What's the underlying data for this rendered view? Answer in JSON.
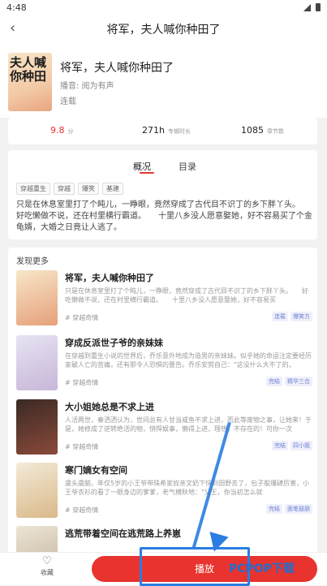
{
  "status_bar": {
    "time": "4:48"
  },
  "nav": {
    "title": "将军，夫人喊你种田了"
  },
  "book": {
    "cover_text": "夫人喊你种田",
    "title": "将军，夫人喊你种田了",
    "narrator": "播音: 阅为有声",
    "status": "连载"
  },
  "stats": [
    {
      "value": "9.8",
      "unit": "分"
    },
    {
      "value": "271h",
      "unit": "专辑时长"
    },
    {
      "value": "1085",
      "unit": "章节数"
    }
  ],
  "tabs": {
    "overview": "概况",
    "catalog": "目录"
  },
  "tags": [
    "穿越重生",
    "穿越",
    "爆笑",
    "基建"
  ],
  "synopsis": "只是在休息室里打了个盹儿，一睁眼，竟然穿成了古代目不识丁的乡下胖丫头。　　好吃懒做不说，还在村里横行霸道。　　十里八乡没人愿意娶她，好不容易买了个金龟婿，大婚之日竟让人逃了。",
  "discover": {
    "heading": "发现更多",
    "items": [
      {
        "title": "将军，夫人喊你种田了",
        "desc": "只是在休息室里打了个盹儿，一睁眼，竟然穿成了古代目不识丁的乡下胖丫头。　　好吃懒做不说，还在村里横行霸道。　　十里八乡没人愿意娶她，好不容易买",
        "genre": "# 穿越奇情",
        "tags": [
          "连载",
          "爆笑方"
        ]
      },
      {
        "title": "穿成反派世子爷的亲妹妹",
        "desc": "在穿越到重生小说的世界后，乔乐意外地成为造男的亲妹妹。似乎她的命运注定要经历家破人亡的苦痛，还有那令人恐惧的噩告。乔乐安努自己：\"这没什么大不了的，",
        "genre": "# 穿越奇情",
        "tags": [
          "完结",
          "精华三合"
        ]
      },
      {
        "title": "大小姐她总是不求上进",
        "desc": "人活两世，秦洒洒认为，世间总有人甘当咸鱼不求上进，而此等废物之事，让她来！于是，她修成了逆转绝活的物，悄悍娱事，懒得上进，理想，不存在的！可你一次",
        "genre": "# 穿越奇情",
        "tags": [
          "完结",
          "四小姐"
        ]
      },
      {
        "title": "寒门嫡女有空间",
        "desc": "虞头虞脑，年仅5岁的小王爷带珠希家奴亲文奶下快到田野去了，包子般爆肆厉害，小王爷衣衫的看了一眼身边的爹爹，老气横秋地：\"父王，你当初怎么就",
        "genre": "# 穿越奇情",
        "tags": [
          "完结",
          "面笔鼓朋"
        ]
      },
      {
        "title": "逃荒带着空间在逃荒路上养崽",
        "desc": "",
        "genre": "",
        "tags": []
      }
    ]
  },
  "bottom": {
    "favorite": "收藏",
    "play": "播放"
  },
  "watermark": "PCPOP下载",
  "colors": {
    "accent": "#e8332e",
    "highlight": "#2a7de1",
    "tag_text": "#6f7fd1"
  },
  "icons": {
    "back": "chevron-left-icon",
    "favorite": "heart-icon",
    "signal": "signal-icon",
    "battery": "battery-icon"
  }
}
